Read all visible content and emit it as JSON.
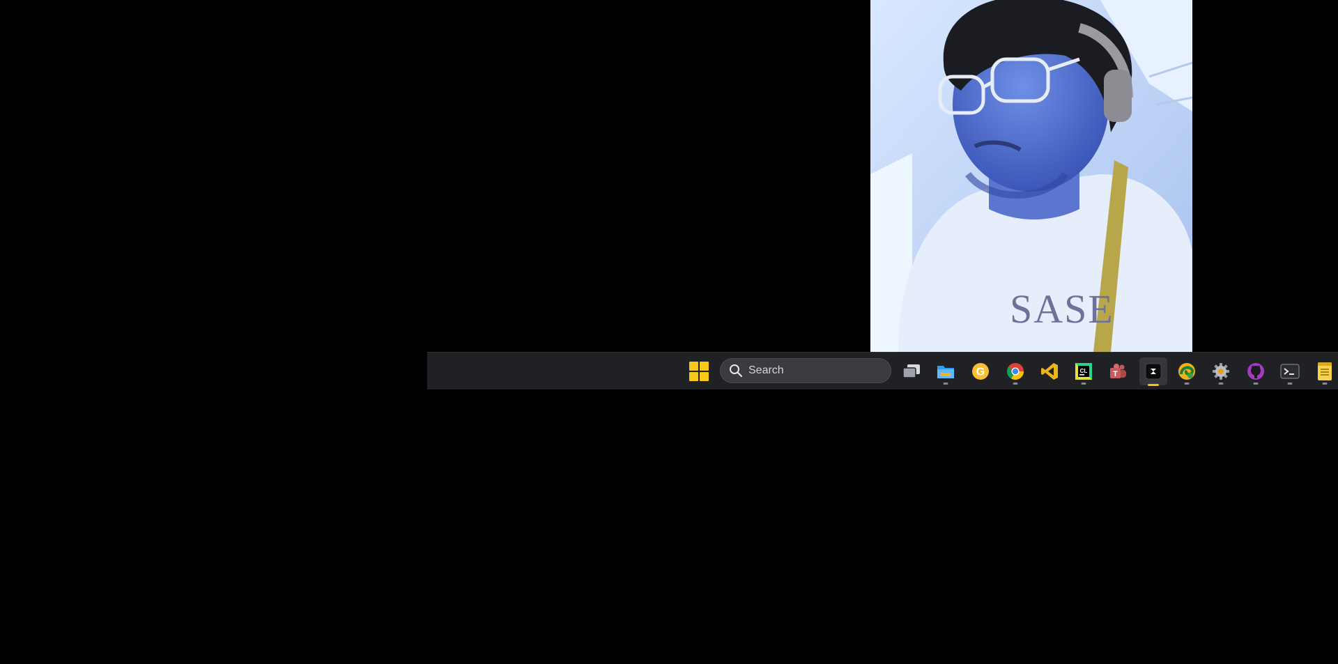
{
  "webcam": {
    "shirt_text": "SASE"
  },
  "taskbar": {
    "search_label": "Search",
    "icons": [
      {
        "name": "task-view-icon",
        "running": false
      },
      {
        "name": "file-explorer-icon",
        "running": true
      },
      {
        "name": "g-app-icon",
        "running": false
      },
      {
        "name": "chrome-icon",
        "running": true
      },
      {
        "name": "visual-studio-icon",
        "running": false
      },
      {
        "name": "clion-icon",
        "running": true
      },
      {
        "name": "teams-icon",
        "running": false
      },
      {
        "name": "dark-app-icon",
        "running": true,
        "active": true
      },
      {
        "name": "edge-canary-icon",
        "running": true
      },
      {
        "name": "settings-gear-icon",
        "running": true
      },
      {
        "name": "github-icon",
        "running": true
      },
      {
        "name": "terminal-icon",
        "running": true
      },
      {
        "name": "notepad-icon",
        "running": true
      }
    ]
  },
  "colors": {
    "taskbar_bg": "#202124",
    "accent": "#f3c318",
    "search_bg": "#3a3b3f"
  }
}
